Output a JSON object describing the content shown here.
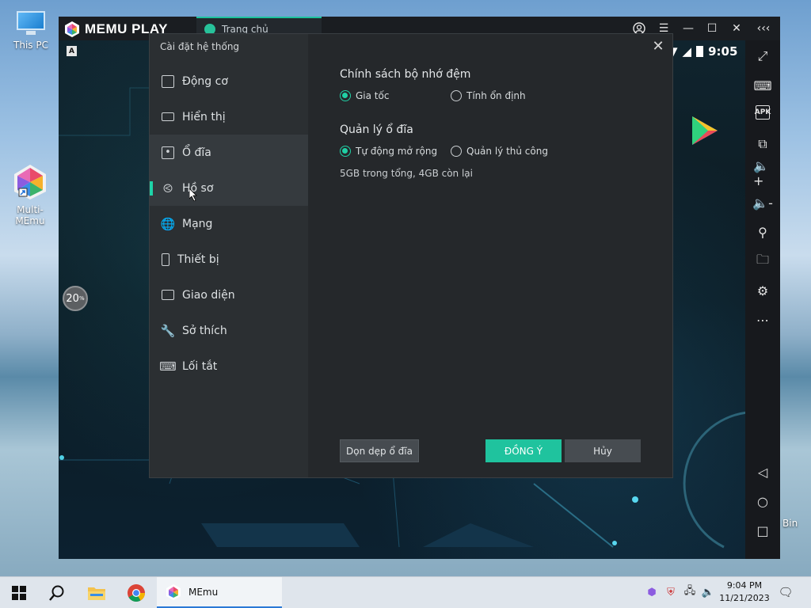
{
  "desktop": {
    "icons": [
      {
        "label": "This PC"
      },
      {
        "label": "Multi-MEmu"
      }
    ],
    "bin_label": "Bin"
  },
  "emulator": {
    "logo_text": "MEMU PLAY",
    "tab_label": "Trang chủ",
    "time": "9:05",
    "a_badge": "A",
    "progress": "20",
    "progress_unit": "%"
  },
  "dialog": {
    "title": "Cài đặt hệ thống",
    "nav": [
      {
        "label": "Động cơ",
        "icon": "cpu-icon"
      },
      {
        "label": "Hiển thị",
        "icon": "monitor-icon"
      },
      {
        "label": "Ổ đĩa",
        "icon": "disk-icon"
      },
      {
        "label": "Hồ sơ",
        "icon": "tag-icon"
      },
      {
        "label": "Mạng",
        "icon": "globe-icon"
      },
      {
        "label": "Thiết bị",
        "icon": "phone-icon"
      },
      {
        "label": "Giao diện",
        "icon": "window-icon"
      },
      {
        "label": "Sở thích",
        "icon": "wrench-icon"
      },
      {
        "label": "Lối tắt",
        "icon": "keyboard-icon"
      }
    ],
    "cache_policy": {
      "title": "Chính sách bộ nhớ đệm",
      "options": [
        "Gia tốc",
        "Tính ổn định"
      ],
      "selected": "Gia tốc"
    },
    "disk_management": {
      "title": "Quản lý ổ đĩa",
      "options": [
        "Tự động mở rộng",
        "Quản lý thủ công"
      ],
      "selected": "Tự động mở rộng",
      "info": "5GB trong tổng, 4GB còn lại"
    },
    "buttons": {
      "clean": "Dọn dẹp ổ đĩa",
      "ok": "ĐỒNG Ý",
      "cancel": "Hủy"
    }
  },
  "taskbar": {
    "app_label": "MEmu",
    "time": "9:04 PM",
    "date": "11/21/2023"
  }
}
